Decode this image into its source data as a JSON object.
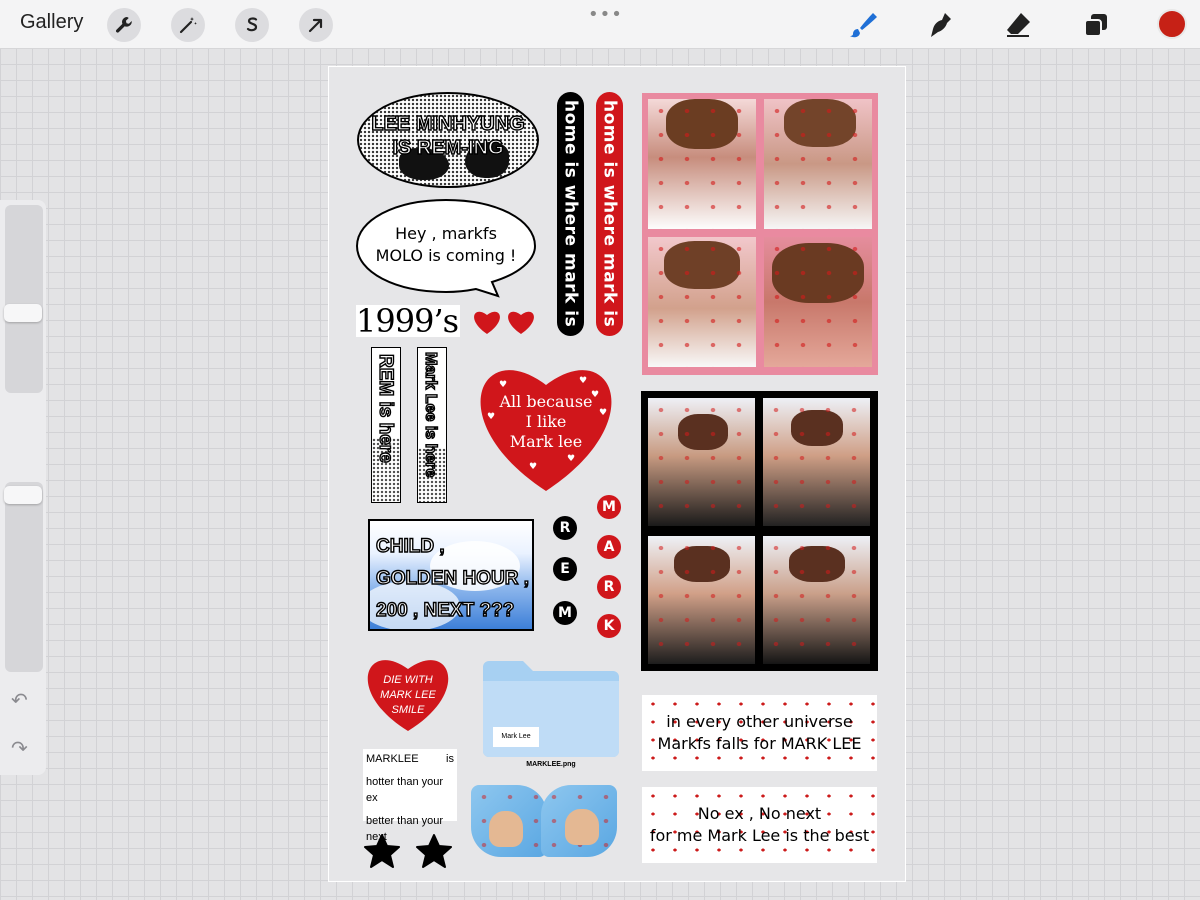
{
  "app": {
    "gallery_label": "Gallery",
    "toolbar_left": [
      "wrench-icon",
      "magic-wand-icon",
      "selection-s-icon",
      "arrow-icon"
    ],
    "more_dots": "•••",
    "toolbar_right": [
      "brush-icon",
      "smudge-icon",
      "eraser-icon",
      "layers-icon",
      "color-swatch"
    ],
    "current_color": "#c62116",
    "undo_glyph": "↶",
    "redo_glyph": "↷"
  },
  "stickers": {
    "oval_title": [
      "LEE MINHYUNG",
      "IS REM-ING"
    ],
    "speech": [
      "Hey , markfs",
      "MOLO is coming !"
    ],
    "year": "1999’s",
    "pill_black": "home is where mark is",
    "pill_red": "home is where mark is",
    "rem_vertical_1": "REM is here",
    "rem_vertical_2": "Mark Lee is here",
    "big_heart": [
      "All because",
      "I like",
      "Mark lee"
    ],
    "sky_card": [
      "CHILD ,",
      "GOLDEN HOUR ,",
      "200 , NEXT ???"
    ],
    "rem_letters": [
      "R",
      "E",
      "M"
    ],
    "mark_letters": [
      "M",
      "A",
      "R",
      "K"
    ],
    "die_heart": [
      "DIE WITH",
      "MARK LEE",
      "SMILE"
    ],
    "folder_label": "Mark Lee",
    "folder_filename": "MARKLEE.png",
    "marklee_note": [
      "MARKLEE",
      "is",
      "hotter than your ex",
      "better than your next"
    ],
    "universe_box": [
      "in every other universe",
      "Markfs falls for MARK LEE"
    ],
    "noex_box": [
      "No ex , No next",
      "for me Mark Lee is the best"
    ]
  },
  "colors": {
    "red": "#d0161b",
    "pink_frame": "#e98aa0",
    "black": "#000000"
  }
}
